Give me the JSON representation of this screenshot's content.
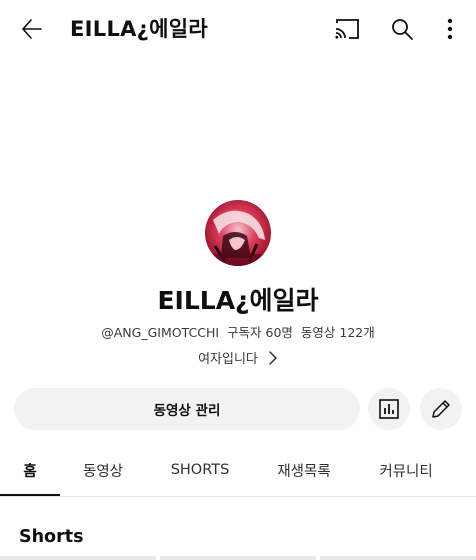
{
  "appbar": {
    "title": "EILLA¿에일라",
    "back_icon": "arrow-left-icon",
    "cast_icon": "cast-icon",
    "search_icon": "search-icon",
    "more_icon": "more-vertical-icon"
  },
  "channel": {
    "name": "EILLA¿에일라",
    "handle": "@ANG_GIMOTCCHI",
    "subscribers": "구독자 60명",
    "videos": "동영상 122개",
    "description": "여자입니다",
    "avatar_colors": [
      "#c8143c",
      "#f3c6cf",
      "#3a0b14"
    ]
  },
  "actions": {
    "manage_label": "동영상 관리",
    "analytics_icon": "bar-chart-icon",
    "edit_icon": "pencil-icon"
  },
  "tabs": [
    {
      "label": "홈",
      "active": true
    },
    {
      "label": "동영상",
      "active": false
    },
    {
      "label": "SHORTS",
      "active": false
    },
    {
      "label": "재생목록",
      "active": false
    },
    {
      "label": "커뮤니티",
      "active": false
    }
  ],
  "sections": {
    "shorts_title": "Shorts"
  }
}
